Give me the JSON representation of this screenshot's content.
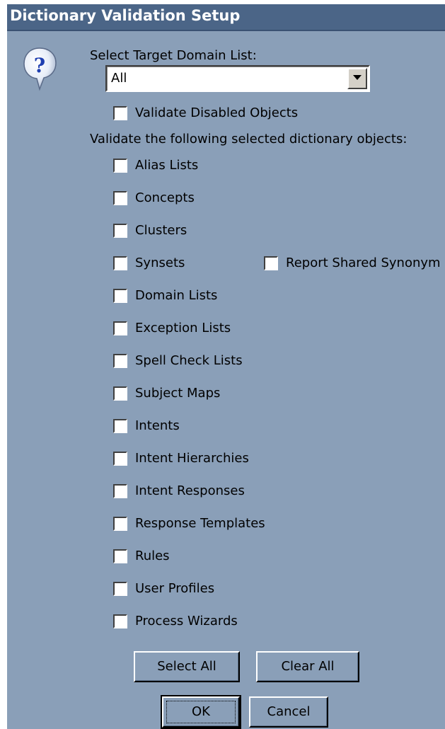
{
  "window": {
    "title": "Dictionary Validation Setup"
  },
  "icons": {
    "help": "question-mark-balloon-icon"
  },
  "target_domain": {
    "label": "Select Target Domain List:",
    "selected": "All"
  },
  "validate_disabled": {
    "label": "Validate Disabled Objects",
    "checked": false
  },
  "objects_heading": "Validate the following selected dictionary objects:",
  "objects": [
    {
      "label": "Alias Lists",
      "checked": false
    },
    {
      "label": "Concepts",
      "checked": false
    },
    {
      "label": "Clusters",
      "checked": false
    },
    {
      "label": "Synsets",
      "checked": false
    },
    {
      "label": "Domain Lists",
      "checked": false
    },
    {
      "label": "Exception Lists",
      "checked": false
    },
    {
      "label": "Spell Check Lists",
      "checked": false
    },
    {
      "label": "Subject Maps",
      "checked": false
    },
    {
      "label": "Intents",
      "checked": false
    },
    {
      "label": "Intent Hierarchies",
      "checked": false
    },
    {
      "label": "Intent Responses",
      "checked": false
    },
    {
      "label": "Response Templates",
      "checked": false
    },
    {
      "label": "Rules",
      "checked": false
    },
    {
      "label": "User Profiles",
      "checked": false
    },
    {
      "label": "Process Wizards",
      "checked": false
    }
  ],
  "report_shared_synonyms": {
    "label": "Report Shared Synonym",
    "checked": false
  },
  "buttons": {
    "select_all": "Select All",
    "clear_all": "Clear All",
    "ok": "OK",
    "cancel": "Cancel"
  },
  "colors": {
    "dialog_bg": "#8a9fb8",
    "titlebar_bg": "#4b6587",
    "titlebar_text": "#ffffff"
  }
}
